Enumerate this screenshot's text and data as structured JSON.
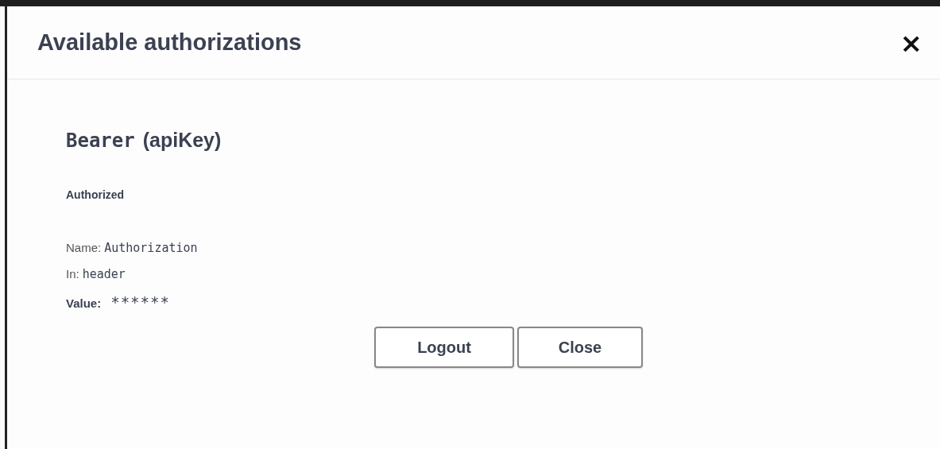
{
  "dialog": {
    "title": "Available authorizations",
    "close": "×"
  },
  "scheme": {
    "name": "Bearer",
    "type": "(apiKey)",
    "status": "Authorized",
    "fields": [
      {
        "label": "Name:",
        "value": "Authorization",
        "kind": "code"
      },
      {
        "label": "In:",
        "value": "header",
        "kind": "code"
      },
      {
        "label": "Value:",
        "value": "******",
        "kind": "secret"
      }
    ]
  },
  "buttons": [
    {
      "label": "Logout"
    },
    {
      "label": "Close"
    }
  ]
}
